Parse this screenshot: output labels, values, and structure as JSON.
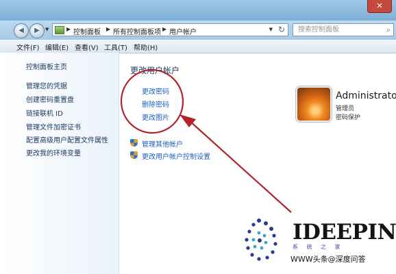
{
  "window": {
    "close_glyph": "✕"
  },
  "address": {
    "crumbs": [
      "控制面板",
      "所有控制面板项",
      "用户帐户"
    ],
    "search_placeholder": "搜索控制面板"
  },
  "menu": [
    "文件(F)",
    "编辑(E)",
    "查看(V)",
    "工具(T)",
    "帮助(H)"
  ],
  "sidebar": {
    "home": "控制面板主页",
    "tasks": [
      "管理您的凭据",
      "创建密码重置盘",
      "链接联机 ID",
      "管理文件加密证书",
      "配置高级用户配置文件属性",
      "更改我的环境变量"
    ]
  },
  "main": {
    "title": "更改用户帐户",
    "links": [
      "更改密码",
      "删除密码",
      "更改图片"
    ],
    "admin_links": [
      "管理其他帐户",
      "更改用户帐户控制设置"
    ]
  },
  "user": {
    "name": "Administrator",
    "role": "管理员",
    "status": "密码保护"
  },
  "annotation": {
    "color": "#b2232d"
  },
  "overlay": {
    "logo": "IDEEPIN",
    "logo_sub": "系 统 之 家",
    "watermark": "WWW头条@深度问答"
  }
}
